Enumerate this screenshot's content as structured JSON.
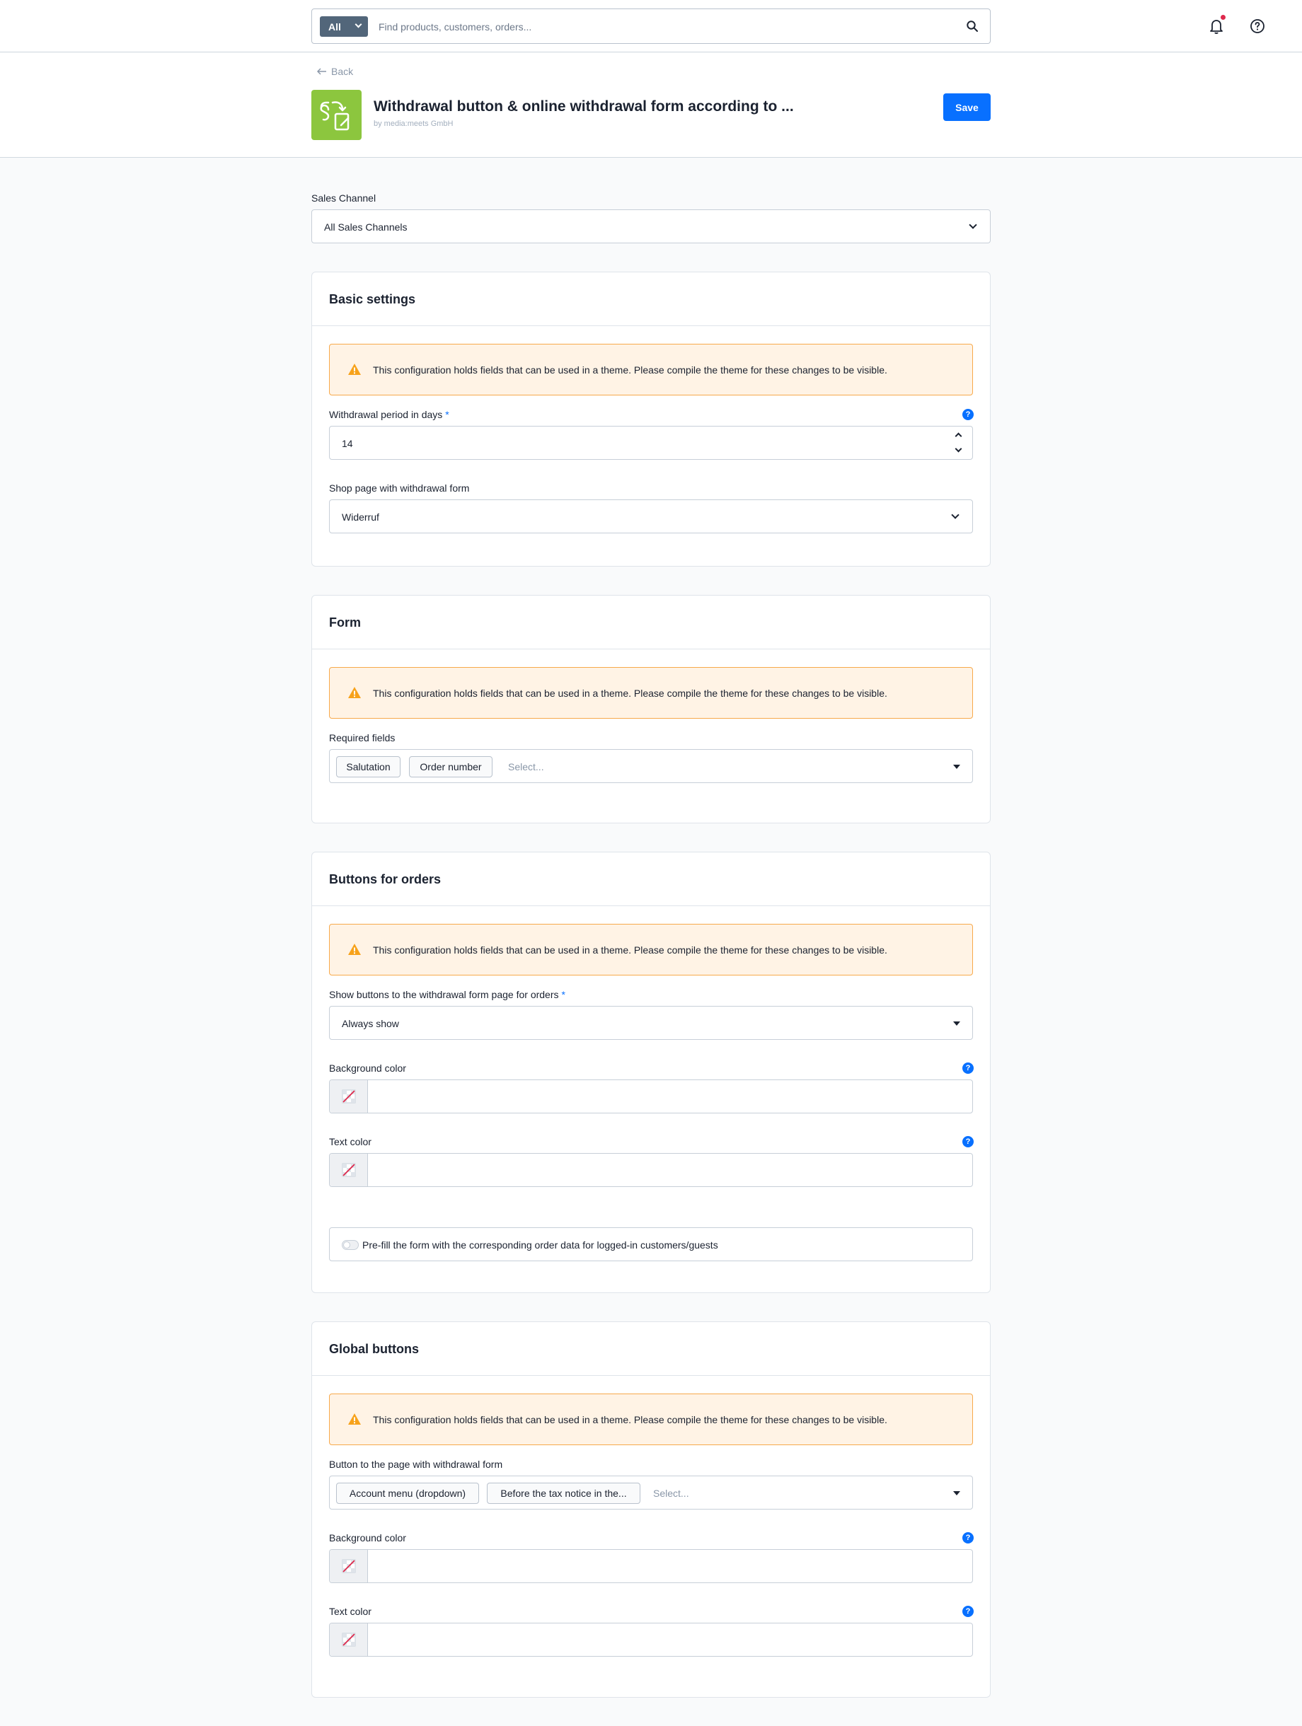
{
  "topbar": {
    "search_type": "All",
    "search_placeholder": "Find products, customers, orders..."
  },
  "header": {
    "back_label": "Back",
    "app_title": "Withdrawal button & online withdrawal form according to ...",
    "app_vendor": "by media:meets GmbH",
    "save_label": "Save"
  },
  "sales_channel": {
    "label": "Sales Channel",
    "value": "All Sales Channels"
  },
  "warning_text": "This configuration holds fields that can be used in a theme. Please compile the theme for these changes to be visible.",
  "basic_settings": {
    "title": "Basic settings",
    "withdrawal_period": {
      "label": "Withdrawal period in days",
      "required": "*",
      "value": "14"
    },
    "shop_page": {
      "label": "Shop page with withdrawal form",
      "value": "Widerruf"
    }
  },
  "form": {
    "title": "Form",
    "required_fields": {
      "label": "Required fields",
      "chips": [
        "Salutation",
        "Order number"
      ],
      "placeholder": "Select..."
    }
  },
  "buttons_for_orders": {
    "title": "Buttons for orders",
    "show_buttons": {
      "label": "Show buttons to the withdrawal form page for orders",
      "required": "*",
      "value": "Always show"
    },
    "background_color": {
      "label": "Background color"
    },
    "text_color": {
      "label": "Text color"
    },
    "prefill": {
      "label": "Pre-fill the form with the corresponding order data for logged-in customers/guests"
    }
  },
  "global_buttons": {
    "title": "Global buttons",
    "button_to_page": {
      "label": "Button to the page with withdrawal form",
      "chips": [
        "Account menu (dropdown)",
        "Before the tax notice in the..."
      ],
      "placeholder": "Select..."
    },
    "background_color": {
      "label": "Background color"
    },
    "text_color": {
      "label": "Text color"
    }
  },
  "help_symbol": "?",
  "colors": {
    "accent": "#0870ff",
    "warning_bg": "#fff3e5",
    "warning_border": "#f7a94b",
    "app_logo": "#8cc63e"
  }
}
